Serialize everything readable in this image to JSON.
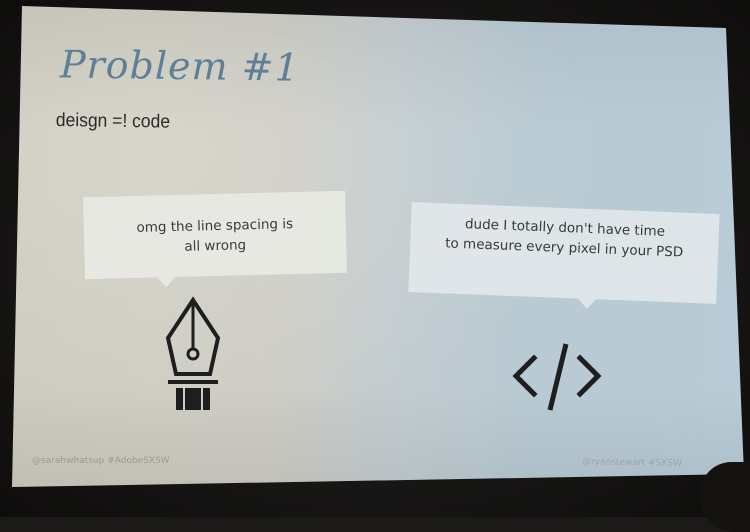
{
  "slide": {
    "title": "Problem #1",
    "subtitle": "deisgn =! code",
    "left_bubble": {
      "line1": "omg the line spacing is",
      "line2": "all wrong"
    },
    "right_bubble": {
      "line1": "dude I totally don't have time",
      "line2": "to measure every pixel in your PSD"
    },
    "footer_left": "@sarahwhatsup #AdobeSXSW",
    "footer_right": "@ryanstewart #SXSW",
    "icons": [
      "pen-nib-icon",
      "code-brackets-icon"
    ],
    "colors": {
      "title": "#5f7f97",
      "left_background": "#cdcbbf",
      "right_background": "#b8cbd6"
    }
  }
}
